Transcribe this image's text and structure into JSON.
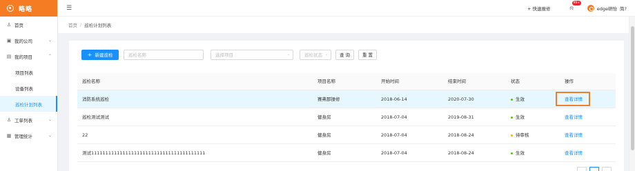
{
  "app": {
    "name": "略略"
  },
  "header": {
    "quick_report": "+ 快速报修",
    "notif_badge": "99+",
    "username": "edge研怡",
    "lang": "简?"
  },
  "breadcrumb": {
    "home": "首页",
    "sep": "/",
    "current": "巡检计划列表"
  },
  "sidebar": {
    "items": [
      {
        "label": "首页",
        "icon": "user-icon"
      },
      {
        "label": "我的公司",
        "icon": "building-icon"
      },
      {
        "label": "我的项目",
        "icon": "project-icon"
      }
    ],
    "subitems": [
      {
        "label": "项目列表"
      },
      {
        "label": "设备列表"
      },
      {
        "label": "巡检计划列表"
      }
    ],
    "items2": [
      {
        "label": "工单列表",
        "icon": "ticket-icon"
      },
      {
        "label": "管理统计",
        "icon": "chart-icon"
      }
    ]
  },
  "toolbar": {
    "new_label": "新建巡检",
    "name_placeholder": "巡检名称",
    "project_placeholder": "选择项目",
    "status_placeholder": "巡检状态",
    "query_label": "查 询",
    "reset_label": "重 置"
  },
  "table": {
    "headers": [
      "巡检名称",
      "项目名称",
      "开始时间",
      "结束时间",
      "状态",
      "操作"
    ],
    "rows": [
      {
        "name": "消防系统巡检",
        "project": "赛弗那操修",
        "start": "2018-06-14",
        "end": "2020-07-30",
        "status": "生效",
        "status_color": "#52c41a",
        "action": "查看详情"
      },
      {
        "name": "巡检测试测试",
        "project": "健身房",
        "start": "2018-07-04",
        "end": "2019-08-31",
        "status": "生效",
        "status_color": "#52c41a",
        "action": "查看详情"
      },
      {
        "name": "22",
        "project": "健身房",
        "start": "2018-07-04",
        "end": "2018-08-24",
        "status": "待审核",
        "status_color": "#faad14",
        "action": "查看详情"
      },
      {
        "name": "测试1111111111111111111111111111111111111111",
        "project": "健身房",
        "start": "2018-07-04",
        "end": "2018-08-24",
        "status": "生效",
        "status_color": "#52c41a",
        "action": "查看详情"
      }
    ]
  },
  "colors": {
    "brand": "#f57c22",
    "primary": "#1890ff",
    "highlight_row": "#e6f7ff"
  }
}
